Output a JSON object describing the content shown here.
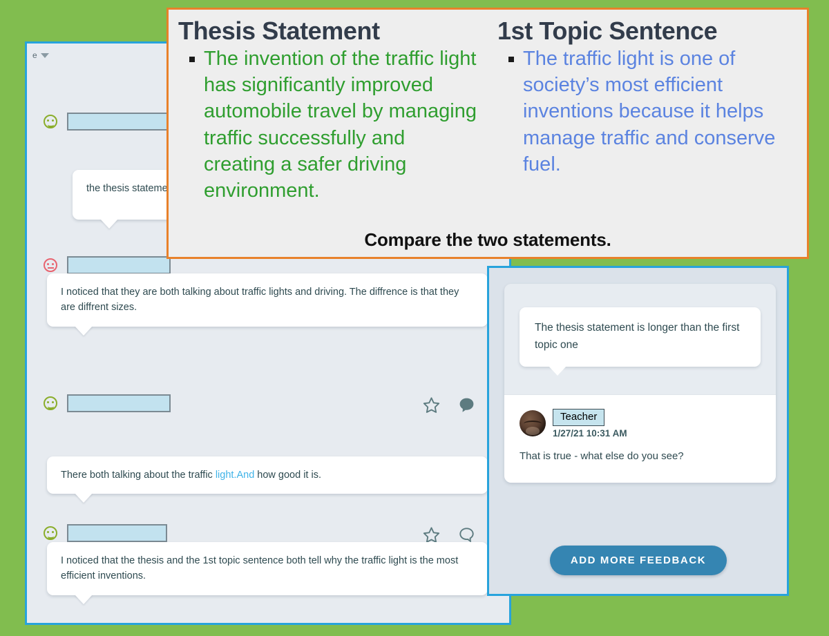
{
  "colors": {
    "background_green": "#81bd4f",
    "panel_border_blue": "#27a3dc",
    "slide_border_orange": "#e8812a",
    "thesis_text_green": "#2f9e2f",
    "topic_text_blue": "#5b83e0",
    "button_blue": "#3585b2",
    "redaction_fill": "#c2e2ef",
    "highlight_blue": "#3fb3e8"
  },
  "chat_panel": {
    "thread_header": {
      "truncated_label": "e",
      "chevron_icon": "chevron-down-icon"
    },
    "messages": [
      {
        "id": "msg-1",
        "reaction_icon": "smiley-face-icon",
        "reaction_mood": "happy",
        "author_redacted": true,
        "redaction_width": 150,
        "bubble": null
      },
      {
        "id": "msg-2",
        "bubble": "the thesis statement  traffic light help to no",
        "bubble_truncated": true
      },
      {
        "id": "msg-3",
        "reaction_icon": "frowning-face-icon",
        "reaction_mood": "sad",
        "author_redacted": true,
        "redaction_width": 150
      },
      {
        "id": "msg-4",
        "bubble": "I noticed that they are both talking about traffic lights and driving. The diffrence is that they are diffrent sizes.",
        "reaction_icon": "smiley-face-icon",
        "reaction_mood": "happy",
        "author_redacted": true,
        "redaction_width": 150,
        "actions": [
          "star-icon",
          "comment-filled-icon",
          "more-options-icon"
        ]
      },
      {
        "id": "msg-5",
        "bubble_prefix": "There both talking about the traffic ",
        "bubble_highlight": "light.And",
        "bubble_suffix": " how good it is.",
        "reaction_icon": "smiley-face-icon",
        "reaction_mood": "happy",
        "author_redacted": true,
        "redaction_width": 145,
        "actions": [
          "star-icon",
          "comment-outline-icon",
          "more-options-icon"
        ]
      },
      {
        "id": "msg-6",
        "bubble": "I noticed that the thesis and the 1st topic sentence both tell why the traffic light is the most efficient inventions."
      }
    ]
  },
  "slide_overlay": {
    "left": {
      "title": "Thesis Statement",
      "bullet": "The invention of the traffic light has significantly improved automobile travel by managing traffic successfully and creating a safer driving environment."
    },
    "right": {
      "title": "1st Topic Sentence",
      "bullet": "The traffic light is one of society’s most efficient inventions because it helps manage traffic and conserve fuel."
    },
    "prompt": "Compare the two statements."
  },
  "feedback_panel": {
    "student_response": "The thesis statement is longer than the first topic one",
    "teacher": {
      "name": "Teacher",
      "timestamp": "1/27/21 10:31 AM",
      "comment": "That is true - what else do you see?",
      "avatar_icon": "teacher-avatar"
    },
    "add_feedback_button": "ADD MORE FEEDBACK"
  }
}
